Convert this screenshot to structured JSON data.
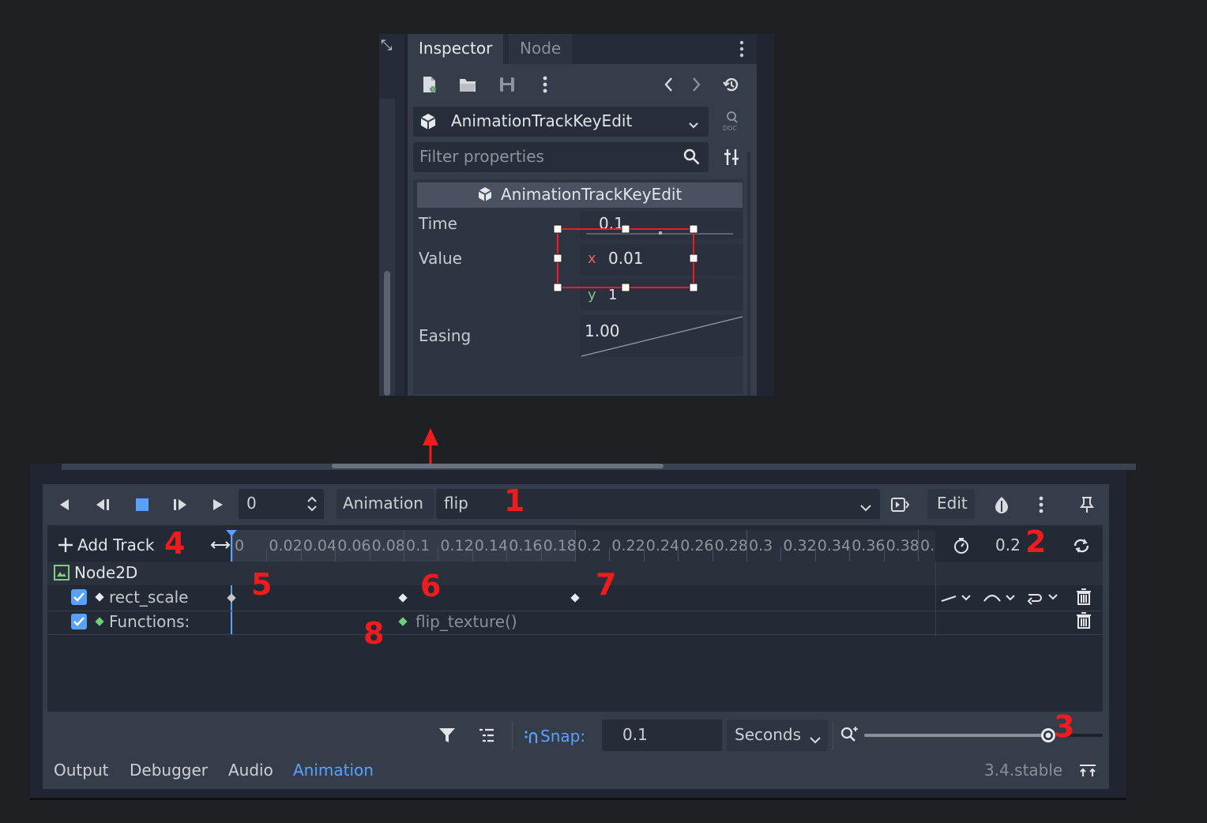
{
  "colors": {
    "accent": "#5aa0ff",
    "annotation_red": "#ee1c1c",
    "keyframe_green": "#6ad07a",
    "axis_x": "#e06666",
    "axis_y": "#7ec77e"
  },
  "inspector": {
    "tabs": [
      "Inspector",
      "Node"
    ],
    "toolbar_icons": [
      "new-resource-icon",
      "open-folder-icon",
      "save-icon",
      "more-vertical-icon",
      "history-back-icon",
      "history-forward-icon",
      "object-history-icon"
    ],
    "class_selector": "AnimationTrackKeyEdit",
    "filter_placeholder": "Filter properties",
    "section_title": "AnimationTrackKeyEdit",
    "properties": {
      "time_label": "Time",
      "time_value": "0.1",
      "value_label": "Value",
      "value_x_label": "x",
      "value_x": "0.01",
      "value_y_label": "y",
      "value_y": "1",
      "easing_label": "Easing",
      "easing_value": "1.00"
    }
  },
  "animation": {
    "time_field": "0",
    "animation_label": "Animation",
    "animation_name": "flip",
    "edit_label": "Edit",
    "add_track": "Add Track",
    "ruler_labels": [
      "0",
      "0.02",
      "0.04",
      "0.06",
      "0.08",
      "0.1",
      "0.12",
      "0.14",
      "0.16",
      "0.18",
      "0.2",
      "0.22",
      "0.24",
      "0.26",
      "0.28",
      "0.3",
      "0.32",
      "0.34",
      "0.36",
      "0.38",
      "0."
    ],
    "length_value": "0.2",
    "node_name": "Node2D",
    "tracks": [
      {
        "name": "rect_scale",
        "checked": true
      },
      {
        "name": "Functions:",
        "checked": true
      }
    ],
    "function_key": "flip_texture()",
    "snap_label": "Snap:",
    "snap_value": "0.1",
    "snap_unit": "Seconds",
    "zoom_level": 0.77
  },
  "bottom_tabs": [
    "Output",
    "Debugger",
    "Audio",
    "Animation"
  ],
  "active_bottom_tab": "Animation",
  "version": "3.4.stable",
  "annotations": [
    "1",
    "2",
    "3",
    "4",
    "5",
    "6",
    "7",
    "8"
  ]
}
